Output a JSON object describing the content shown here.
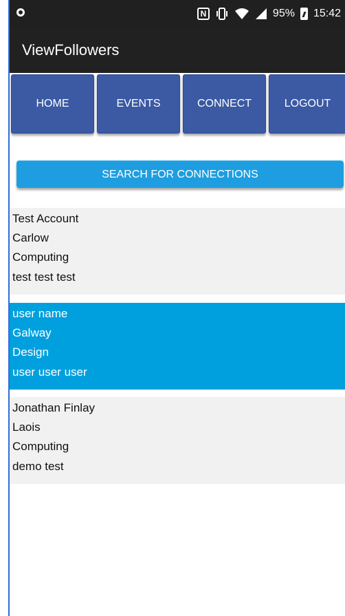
{
  "status_bar": {
    "battery_percent": "95%",
    "time": "15:42",
    "icons": [
      "notification-dot-icon",
      "nfc-icon",
      "vibrate-icon",
      "wifi-icon",
      "signal-icon",
      "battery-icon"
    ]
  },
  "app_bar": {
    "title": "ViewFollowers"
  },
  "nav": {
    "home": "HOME",
    "events": "EVENTS",
    "connect": "CONNECT",
    "logout": "LOGOUT"
  },
  "search": {
    "label": "SEARCH FOR CONNECTIONS"
  },
  "followers": [
    {
      "name": "Test Account",
      "location": "Carlow",
      "field": "Computing",
      "bio": "test test test",
      "selected": false
    },
    {
      "name": "user name",
      "location": "Galway",
      "field": "Design",
      "bio": "user user user",
      "selected": true
    },
    {
      "name": "Jonathan Finlay",
      "location": "Laois",
      "field": "Computing",
      "bio": "demo test",
      "selected": false
    }
  ],
  "colors": {
    "status_bar_bg": "#202020",
    "app_bar_bg": "#212121",
    "nav_button_bg": "#3b5aa3",
    "search_button_bg": "#1e9ee0",
    "list_item_bg": "#f1f1f1",
    "list_item_selected_bg": "#00a0de"
  }
}
